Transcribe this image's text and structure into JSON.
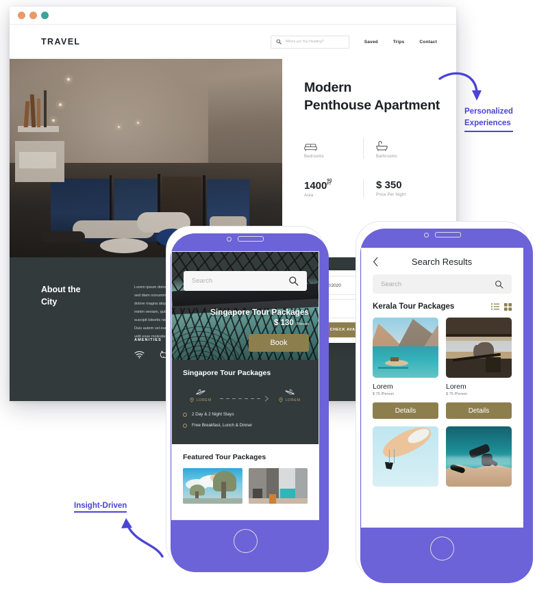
{
  "browser": {
    "dots": [
      "#ea9a68",
      "#ea9a68",
      "#3ba397"
    ],
    "brand": "TRAVEL",
    "search": {
      "placeholder": "Where are You Heading?",
      "icon": "search-icon"
    },
    "nav_links": [
      "Saved",
      "Trips",
      "Contact"
    ]
  },
  "property": {
    "title": "Modern\nPenthouse Apartment",
    "title_line1": "Modern",
    "title_line2": "Penthouse Apartment",
    "specs": [
      {
        "icon": "bed-icon",
        "label": "Bedrooms"
      },
      {
        "icon": "bathtub-icon",
        "label": "Bathrooms"
      }
    ],
    "stats": [
      {
        "value": "1400",
        "unit_top": "SQ",
        "unit_bottom": "FT",
        "label": "Area"
      },
      {
        "value": "$ 350",
        "label": "Price Per Night"
      }
    ]
  },
  "about": {
    "heading_line1": "About the",
    "heading_line2": "City",
    "body": "Lorem ipsum dolor sit amet, consectetuer adipiscing elit, sed diam nonummy nibh euismod tincidunt ut laoreet dolore magna aliquam erat volutpat. Ut wisi enim ad minim veniam, quis nostrud exerci tation ullamcorper suscipit lobortis nisl ut aliquip ex ea commodo consequat. Duis autem vel eum iriure dolor in hendrerit in vulputate velit esse molestie consequat.",
    "amenities_heading": "AMENITIES",
    "amenities": [
      "wifi-icon",
      "pet-friendly-icon"
    ]
  },
  "booking": {
    "date_value": "7/02/2020",
    "second_field_value": "",
    "button_label": "CHECK AVAILABILITY"
  },
  "phone1": {
    "search_placeholder": "Search",
    "hero_title": "Singapore Tour Packages",
    "hero_price": "$ 130",
    "hero_price_unit": "/Person",
    "book_label": "Book",
    "section_title": "Singapore Tour Packages",
    "route": {
      "from": "LOREM",
      "to": "LOREM",
      "depart_icon": "plane-depart-icon",
      "arrive_icon": "plane-arrive-icon"
    },
    "features": [
      "2 Day & 2 Night Stays",
      "Free Breakfast, Lunch & Dinner"
    ],
    "featured_heading": "Featured Tour Packages"
  },
  "phone2": {
    "back_icon": "chevron-left-icon",
    "title": "Search Results",
    "search_placeholder": "Search",
    "section_title": "Kerala Tour Packages",
    "view_toggles": [
      "list-view-icon",
      "grid-view-icon"
    ],
    "cards": [
      {
        "name": "Lorem",
        "price": "$ 75",
        "price_unit": "/Person",
        "button": "Details",
        "image": "lake-boat-photo"
      },
      {
        "name": "Lorem",
        "price": "$ 75",
        "price_unit": "/Person",
        "button": "Details",
        "image": "safari-elephant-photo"
      },
      {
        "image": "paragliding-photo"
      },
      {
        "image": "snorkeling-photo"
      }
    ]
  },
  "annotations": [
    {
      "text_line1": "Personalized",
      "text_line2": "Experiences"
    },
    {
      "text": "Insight-Driven"
    }
  ],
  "colors": {
    "accent_gold": "#8d7e4e",
    "dark_panel": "#323a3c",
    "annotation_blue": "#4b44d6",
    "phone_shadow": "#6c63d8"
  }
}
